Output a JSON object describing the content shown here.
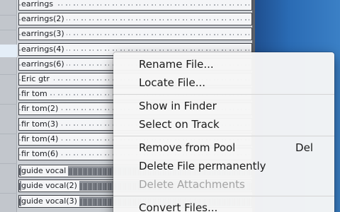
{
  "pool": {
    "clips": [
      {
        "name": "earrings",
        "style": "light"
      },
      {
        "name": "earrings(2)",
        "style": "light"
      },
      {
        "name": "earrings(3)",
        "style": "light"
      },
      {
        "name": "earrings(4)",
        "style": "light"
      },
      {
        "name": "earrings(6)",
        "style": "light"
      },
      {
        "name": "Eric gtr",
        "style": "light"
      },
      {
        "name": "fir tom",
        "style": "light"
      },
      {
        "name": "fir tom(2)",
        "style": "light"
      },
      {
        "name": "fir tom(3)",
        "style": "light"
      },
      {
        "name": "fir tom(4)",
        "style": "light"
      },
      {
        "name": "fir tom(6)",
        "style": "light"
      },
      {
        "name": "guide vocal",
        "style": "dark"
      },
      {
        "name": "guide vocal(2)",
        "style": "dark"
      },
      {
        "name": "guide vocal(3)",
        "style": "dark"
      }
    ]
  },
  "context_menu": {
    "rename_file": "Rename File...",
    "locate_file": "Locate File...",
    "show_in_finder": "Show in Finder",
    "select_on_track": "Select on Track",
    "remove_from_pool": "Remove from Pool",
    "remove_shortcut": "Del",
    "delete_permanently": "Delete File permanently",
    "delete_attachments": "Delete Attachments",
    "convert_files": "Convert Files..."
  },
  "colors": {
    "menu_background": "#f6f6f6",
    "disabled_text": "#a3a3a3",
    "desktop_blue": "#2a6bb4"
  }
}
